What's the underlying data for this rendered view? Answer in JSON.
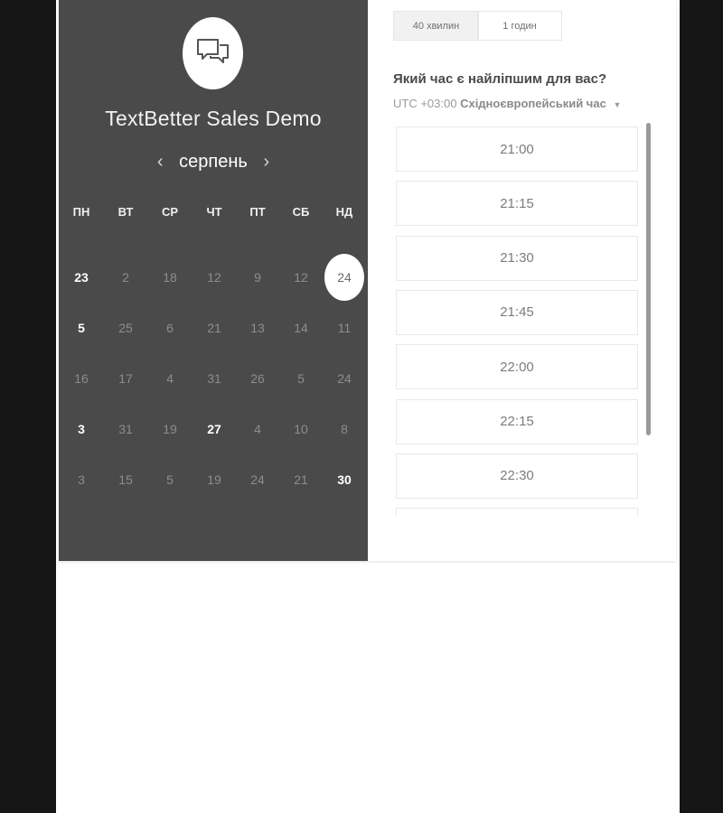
{
  "title": "TextBetter Sales Demo",
  "calendar": {
    "month": "серпень",
    "prev_glyph": "‹",
    "next_glyph": "›",
    "weekdays": [
      "ПН",
      "ВТ",
      "СР",
      "ЧТ",
      "ПТ",
      "СБ",
      "НД"
    ],
    "weeks": [
      [
        {
          "d": "23",
          "s": "avail"
        },
        {
          "d": "2",
          "s": "off"
        },
        {
          "d": "18",
          "s": "off"
        },
        {
          "d": "12",
          "s": "off"
        },
        {
          "d": "9",
          "s": "off"
        },
        {
          "d": "12",
          "s": "off"
        },
        {
          "d": "24",
          "s": "sel"
        }
      ],
      [
        {
          "d": "5",
          "s": "avail"
        },
        {
          "d": "25",
          "s": "off"
        },
        {
          "d": "6",
          "s": "off"
        },
        {
          "d": "21",
          "s": "off"
        },
        {
          "d": "13",
          "s": "off"
        },
        {
          "d": "14",
          "s": "off"
        },
        {
          "d": "11",
          "s": "off"
        }
      ],
      [
        {
          "d": "16",
          "s": "off"
        },
        {
          "d": "17",
          "s": "off"
        },
        {
          "d": "4",
          "s": "off"
        },
        {
          "d": "31",
          "s": "off"
        },
        {
          "d": "26",
          "s": "off"
        },
        {
          "d": "5",
          "s": "off"
        },
        {
          "d": "24",
          "s": "off"
        }
      ],
      [
        {
          "d": "3",
          "s": "avail"
        },
        {
          "d": "31",
          "s": "off"
        },
        {
          "d": "19",
          "s": "off"
        },
        {
          "d": "27",
          "s": "avail"
        },
        {
          "d": "4",
          "s": "off"
        },
        {
          "d": "10",
          "s": "off"
        },
        {
          "d": "8",
          "s": "off"
        }
      ],
      [
        {
          "d": "3",
          "s": "off"
        },
        {
          "d": "15",
          "s": "off"
        },
        {
          "d": "5",
          "s": "off"
        },
        {
          "d": "19",
          "s": "off"
        },
        {
          "d": "24",
          "s": "off"
        },
        {
          "d": "21",
          "s": "off"
        },
        {
          "d": "30",
          "s": "avail"
        }
      ]
    ]
  },
  "durations": [
    {
      "label": "40 хвилин",
      "active": true
    },
    {
      "label": "1 годин",
      "active": false
    }
  ],
  "question": "Який час є найліпшим для вас?",
  "timezone": {
    "offset": "UTC +03:00",
    "name": "Східноєвропейський час"
  },
  "slots": [
    "21:00",
    "21:15",
    "21:30",
    "21:45",
    "22:00",
    "22:15",
    "22:30",
    ""
  ],
  "icons": {
    "logo": "chat-bubbles-icon",
    "timezone_caret": "caret-down-icon"
  }
}
